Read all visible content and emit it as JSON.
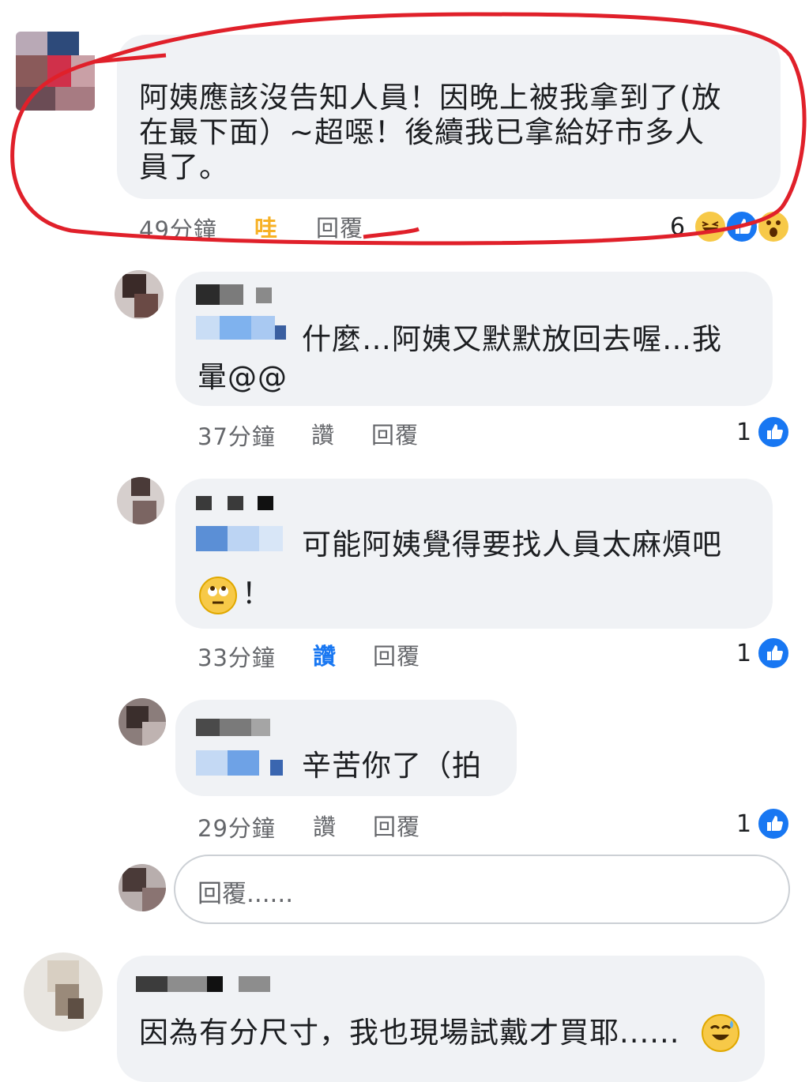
{
  "comments": [
    {
      "text_lines": [
        "阿姨應該沒告知人員！因晚上被我拿到了(放",
        "在最下面）~超噁！後續我已拿給好市多人",
        "員了。"
      ],
      "time": "49分鐘",
      "reaction_label": "哇",
      "reply_label": "回覆",
      "reaction_count": "6",
      "reaction_icons": [
        "haha-icon",
        "like-icon",
        "wow-icon"
      ]
    },
    {
      "text_lines": [
        "什麼…阿姨又默默放回去喔…我",
        "暈@@"
      ],
      "time": "37分鐘",
      "reaction_label": "讚",
      "reply_label": "回覆",
      "reaction_count": "1"
    },
    {
      "text_lines": [
        "可能阿姨覺得要找人員太麻煩吧",
        "！"
      ],
      "time": "33分鐘",
      "reaction_label": "讚",
      "reply_label": "回覆",
      "reaction_count": "1"
    },
    {
      "text_lines": [
        "辛苦你了（拍"
      ],
      "time": "29分鐘",
      "reaction_label": "讚",
      "reply_label": "回覆",
      "reaction_count": "1"
    },
    {
      "text_lines": [
        "因為有分尺寸，我也現場試戴才買耶......"
      ]
    }
  ],
  "reply_input": {
    "placeholder": "回覆......"
  },
  "colors": {
    "highlight_circle": "#e0202a",
    "like_blue": "#1877f2",
    "bubble_bg": "#f0f2f5"
  }
}
